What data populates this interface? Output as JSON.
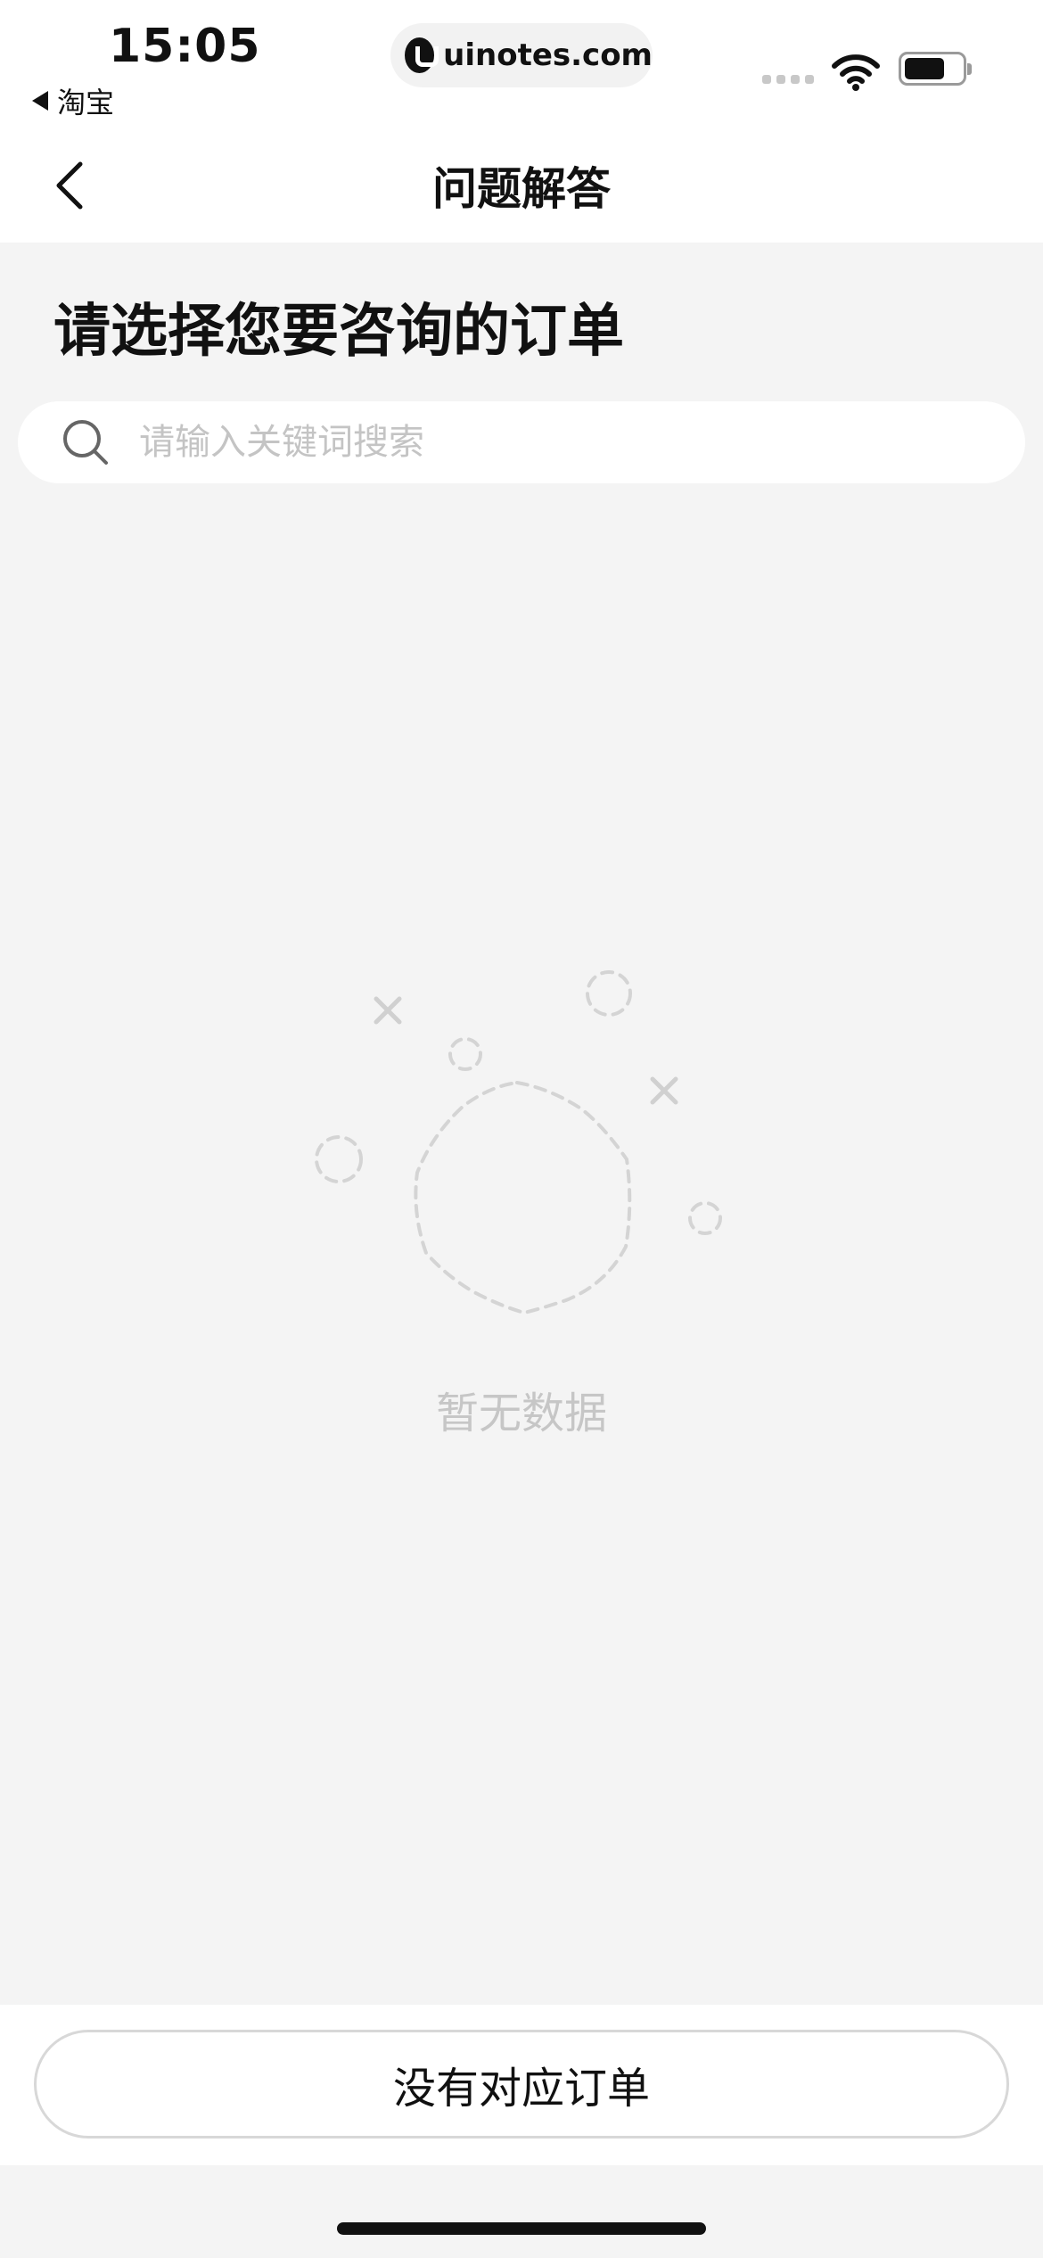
{
  "status_bar": {
    "time": "15:05",
    "back_app_label": "淘宝",
    "url": "uinotes.com"
  },
  "nav": {
    "title": "问题解答"
  },
  "content": {
    "section_title": "请选择您要咨询的订单",
    "search_placeholder": "请输入关键词搜索",
    "empty_state_text": "暂无数据"
  },
  "footer": {
    "no_order_button_label": "没有对应订单"
  },
  "colors": {
    "page_background": "#f4f4f4",
    "surface": "#ffffff",
    "muted_text": "#c6c6c6",
    "illustration_stroke": "#d4d4d4"
  },
  "icons": [
    "back-triangle-icon",
    "site-logo-icon",
    "signal-icon",
    "wifi-icon",
    "battery-icon",
    "chevron-left-icon",
    "search-icon",
    "empty-state-illustration"
  ]
}
